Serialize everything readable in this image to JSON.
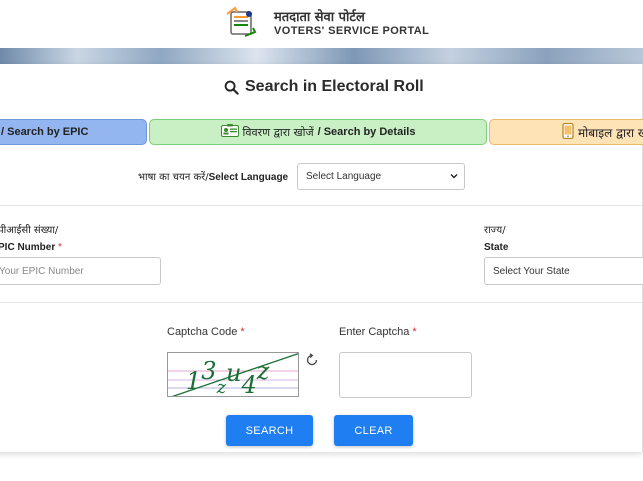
{
  "header": {
    "title_hindi": "मतदाता सेवा पोर्टल",
    "title_english": "VOTERS' SERVICE PORTAL"
  },
  "page": {
    "heading": "Search in Electoral Roll"
  },
  "tabs": [
    {
      "label": "/ Search by EPIC",
      "icon": "none"
    },
    {
      "label_hindi": "विवरण द्वारा खोजें",
      "label": "/ Search by Details",
      "icon": "id-card-icon"
    },
    {
      "label_hindi": "मोबाइल द्वारा ख",
      "icon": "mobile-phone-icon"
    }
  ],
  "language": {
    "label_hindi": "भाषा का चयन करें/",
    "label": "Select Language",
    "selected": "Select Language"
  },
  "epic": {
    "label_hindi": "पीआईसी संख्या/",
    "label": "PIC Number",
    "required_mark": "*",
    "placeholder": "Your EPIC Number"
  },
  "state": {
    "label_hindi": "राज्य/",
    "label": "State",
    "selected": "Select Your State"
  },
  "captcha": {
    "code_label": "Captcha Code",
    "enter_label": "Enter Captcha",
    "required_mark": "*",
    "image_text": "13zu4z"
  },
  "buttons": {
    "search": "SEARCH",
    "clear": "CLEAR"
  },
  "colors": {
    "primary_button": "#1e7ef2",
    "tab_epic": "#93b6f0",
    "tab_details": "#c8f0c4",
    "tab_mobile": "#fde3b5",
    "required": "#d32f2f"
  }
}
